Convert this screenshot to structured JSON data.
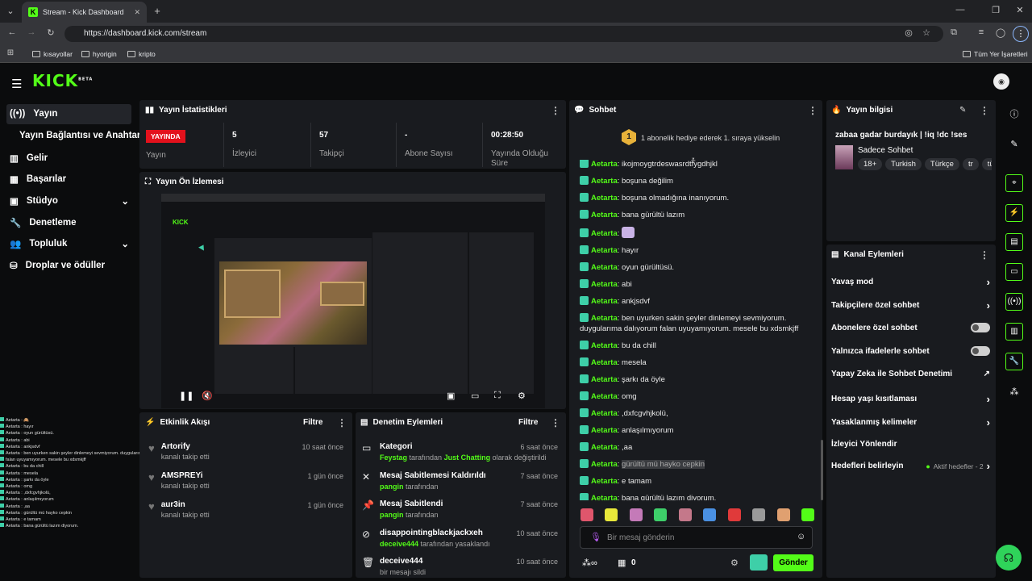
{
  "browser": {
    "tab_title": "Stream - Kick Dashboard",
    "url": "https://dashboard.kick.com/stream",
    "bookmarks": [
      "kısayollar",
      "hyorigin",
      "kripto"
    ],
    "bookmarks_right": "Tüm Yer İşaretleri"
  },
  "logo": "KICK",
  "logo_sup": "BETA",
  "sidebar": {
    "items": [
      {
        "label": "Yayın",
        "icon": "broadcast-icon"
      },
      {
        "label": "Yayın Bağlantısı ve Anahtarı"
      },
      {
        "label": "Gelir",
        "icon": "revenue-icon"
      },
      {
        "label": "Başarılar",
        "icon": "achievements-icon"
      },
      {
        "label": "Stüdyo",
        "icon": "studio-icon"
      },
      {
        "label": "Denetleme",
        "icon": "wrench-icon"
      },
      {
        "label": "Topluluk",
        "icon": "community-icon"
      },
      {
        "label": "Droplar ve ödüller",
        "icon": "drops-icon"
      }
    ]
  },
  "stats": {
    "title": "Yayın İstatistikleri",
    "live_badge": "YAYINDA",
    "live_label": "Yayın",
    "items": [
      {
        "value": "5",
        "label": "İzleyici"
      },
      {
        "value": "57",
        "label": "Takipçi"
      },
      {
        "value": "-",
        "label": "Abone Sayısı"
      },
      {
        "value": "00:28:50",
        "label": "Yayında Olduğu Süre"
      }
    ]
  },
  "preview": {
    "title": "Yayın Ön İzlemesi"
  },
  "activity": {
    "title": "Etkinlik Akışı",
    "filter": "Filtre",
    "items": [
      {
        "name": "Artorify",
        "sub": "kanalı takip etti",
        "time": "10 saat önce"
      },
      {
        "name": "AMSPREYi",
        "sub": "kanalı takip etti",
        "time": "1 gün önce"
      },
      {
        "name": "aur3in",
        "sub": "kanalı takip etti",
        "time": "1 gün önce"
      }
    ]
  },
  "moderation": {
    "title": "Denetim Eylemleri",
    "filter": "Filtre",
    "items": [
      {
        "title": "Kategori",
        "actor": "Feystag",
        "mid": " tarafından ",
        "target": "Just Chatting",
        "end": " olarak değiştirildi",
        "time": "6 saat önce"
      },
      {
        "title": "Mesaj Sabitlemesi Kaldırıldı",
        "actor": "pangin",
        "mid": " tarafından",
        "target": "",
        "end": "",
        "time": "7 saat önce"
      },
      {
        "title": "Mesaj Sabitlendi",
        "actor": "pangin",
        "mid": " tarafından",
        "target": "",
        "end": "",
        "time": "7 saat önce"
      },
      {
        "title": "disappointingblackjackxeh",
        "actor": "deceive444",
        "mid": " tarafından yasaklandı",
        "target": "",
        "end": "",
        "time": "10 saat önce"
      },
      {
        "title": "deceive444",
        "actor": "",
        "mid": "bir mesajı sildi",
        "target": "",
        "end": "",
        "time": "10 saat önce"
      }
    ]
  },
  "chat": {
    "title": "Sohbet",
    "gift_text": "1 abonelik hediye ederek 1. sıraya yükselin",
    "gift_num": "1",
    "user": "Aetarta",
    "messages": [
      "ikojmoygtrdeswasrdtfygdhjkl",
      "boşuna değilim",
      "boşuna olmadığına inanıyorum.",
      "bana gürültü lazım",
      "",
      "hayır",
      "oyun gürültüsü.",
      "abi",
      "ankjsdvf",
      "ben uyurken sakin şeyler dinlemeyi sevmiyorum. duygularıma dalıyorum falan uyuyamıyorum. mesele bu xdsmkjff",
      "bu da chill",
      "mesela",
      "şarkı da öyle",
      "omg",
      ",dxfcgvhjkolü,",
      "anlaşılmıyorum",
      ",aa",
      "gürültü mü hayko cepkin",
      "e tamam",
      "bana gürültü lazım diyorum."
    ],
    "placeholder": "Bir mesaj gönderin",
    "send": "Gönder",
    "count": "0"
  },
  "info": {
    "title": "Yayın bilgisi",
    "stream_title": "zabaa gadar burdayık | !iq !dc !ses",
    "category": "Sadece Sohbet",
    "tags": [
      "18+",
      "Turkish",
      "Türkçe",
      "tr",
      "tü"
    ]
  },
  "channel": {
    "title": "Kanal Eylemleri",
    "items": [
      {
        "label": "Yavaş mod",
        "ctrl": "arrow"
      },
      {
        "label": "Takipçilere özel sohbet",
        "ctrl": "arrow"
      },
      {
        "label": "Abonelere özel sohbet",
        "ctrl": "toggle"
      },
      {
        "label": "Yalnızca ifadelerle sohbet",
        "ctrl": "toggle"
      },
      {
        "label": "Yapay Zeka ile Sohbet Denetimi",
        "ctrl": "ext"
      },
      {
        "label": "Hesap yaşı kısıtlaması",
        "ctrl": "arrow"
      },
      {
        "label": "Yasaklanmış kelimeler",
        "ctrl": "arrow"
      },
      {
        "label": "İzleyici Yönlendir",
        "ctrl": "none"
      },
      {
        "label": "Hedefleri belirleyin",
        "ctrl": "arrow",
        "extra": "Aktif hedefler - 2"
      }
    ]
  },
  "overlay_chat": [
    "Aetarta : 🙈",
    "Aetarta : hayır",
    "Aetarta : oyun gürültüsü.",
    "Aetarta : abi",
    "Aetarta : ankjsdvf",
    "Aetarta : ben uyurken sakin şeyler dinlemeyi sevmiyorum. duygularıma dalıyorum",
    "falan uyuyamıyorum. mesele bu xdsmkjff",
    "Aetarta : bu da chill",
    "Aetarta : mesela",
    "Aetarta : şarkı da öyle",
    "Aetarta : omg",
    "Aetarta : ,dxfcgvhjkolü,",
    "Aetarta : anlaşılmıyorum",
    "Aetarta : ,aa",
    "Aetarta : gürültü mü hayko cepkin",
    "Aetarta : e tamam",
    "Aetarta : bana gürültü lazım diyorum."
  ]
}
